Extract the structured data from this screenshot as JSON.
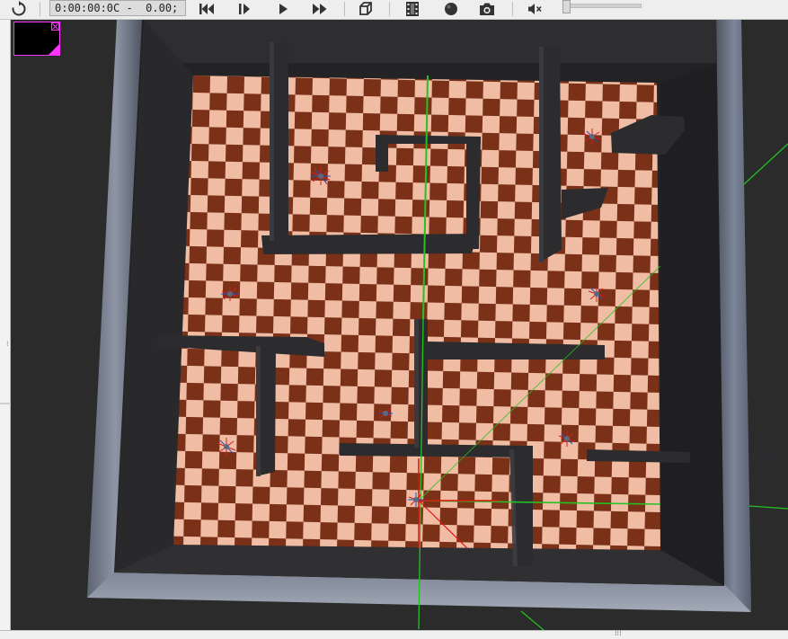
{
  "toolbar": {
    "time_display": "0:00:00:0C -  0.00;",
    "buttons": [
      {
        "name": "refresh-icon",
        "label": "reload"
      },
      {
        "name": "rewind-icon",
        "label": "rewind"
      },
      {
        "name": "step-icon",
        "label": "step"
      },
      {
        "name": "play-icon",
        "label": "play"
      },
      {
        "name": "fast-forward-icon",
        "label": "fast forward"
      },
      {
        "name": "object-icon",
        "label": "add object"
      },
      {
        "name": "film-icon",
        "label": "record movie"
      },
      {
        "name": "sphere-icon",
        "label": "render"
      },
      {
        "name": "camera-icon",
        "label": "screenshot"
      },
      {
        "name": "volume-muted-icon",
        "label": "mute"
      }
    ],
    "volume_level": 0.0
  },
  "scene": {
    "floor_colors": {
      "dark": "#7b3118",
      "light": "#f0bca4"
    },
    "wall_color": "#2c2c2e",
    "rim_color": "#6c7587",
    "grid_color": "#22c322",
    "axis_red": "#e01010"
  },
  "overlay": {
    "border_color": "#ff33ff"
  }
}
